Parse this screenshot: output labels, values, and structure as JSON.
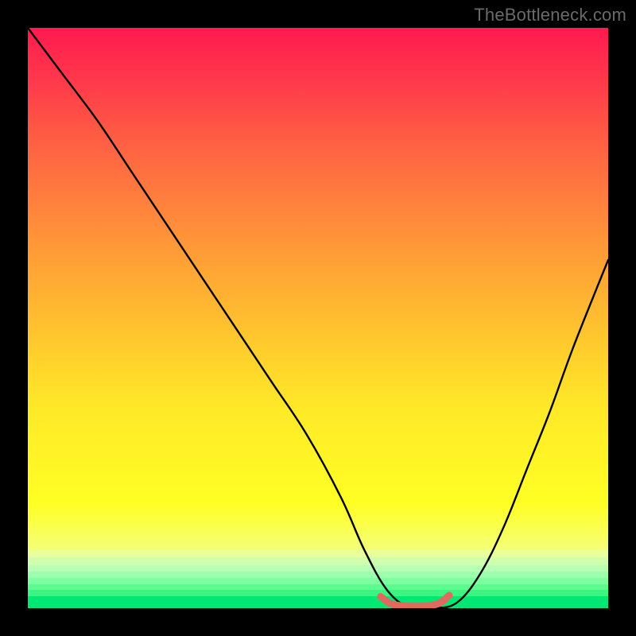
{
  "watermark": "TheBottleneck.com",
  "chart_data": {
    "type": "line",
    "title": "",
    "xlabel": "",
    "ylabel": "",
    "xlim": [
      0,
      100
    ],
    "ylim": [
      0,
      100
    ],
    "grid": false,
    "series": [
      {
        "name": "bottleneck-curve",
        "x": [
          0,
          6,
          12,
          18,
          24,
          30,
          36,
          42,
          48,
          54,
          58,
          62,
          66,
          70,
          74,
          78,
          82,
          86,
          90,
          94,
          100
        ],
        "values": [
          100,
          92,
          84,
          75,
          66,
          57,
          48,
          39,
          30,
          19,
          10,
          3,
          0,
          0,
          1,
          6,
          14,
          24,
          34,
          45,
          60
        ]
      },
      {
        "name": "optimal-marker",
        "x": [
          60.8,
          62.5,
          64.5,
          67.0,
          69.0,
          71.0,
          72.6
        ],
        "values": [
          2.0,
          0.8,
          0.4,
          0.3,
          0.4,
          0.9,
          2.2
        ]
      }
    ],
    "colors": {
      "curve": "#000000",
      "marker": "#e06960",
      "gradient_top": "#ff1a4f",
      "gradient_mid": "#ffd32b",
      "gradient_bottom": "#00e874"
    },
    "green_stripes": [
      {
        "offset_pct": 0,
        "height_pct": 1.3,
        "color": "#e9ff9e"
      },
      {
        "offset_pct": 1.3,
        "height_pct": 1.3,
        "color": "#d0ffae"
      },
      {
        "offset_pct": 2.6,
        "height_pct": 1.1,
        "color": "#b7ffb2"
      },
      {
        "offset_pct": 3.7,
        "height_pct": 1.1,
        "color": "#9cffad"
      },
      {
        "offset_pct": 4.8,
        "height_pct": 1.1,
        "color": "#7dff9f"
      },
      {
        "offset_pct": 5.9,
        "height_pct": 1.0,
        "color": "#5cfb8f"
      },
      {
        "offset_pct": 6.9,
        "height_pct": 1.0,
        "color": "#3bf582"
      },
      {
        "offset_pct": 7.9,
        "height_pct": 2.1,
        "color": "#00e874"
      }
    ]
  }
}
